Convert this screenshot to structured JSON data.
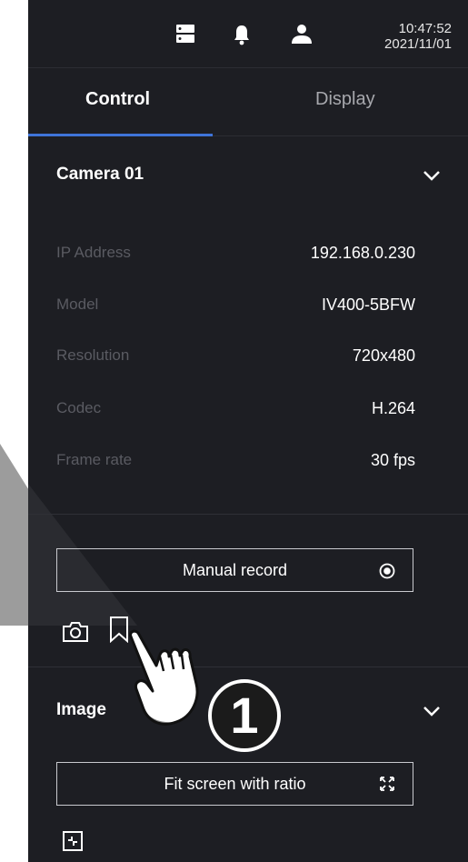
{
  "header": {
    "time": "10:47:52",
    "date": "2021/11/01",
    "icons": [
      "server-icon",
      "bell-icon",
      "user-icon"
    ]
  },
  "tabs": [
    {
      "label": "Control",
      "active": true
    },
    {
      "label": "Display",
      "active": false
    }
  ],
  "camera": {
    "title": "Camera 01",
    "rows": [
      {
        "label": "IP Address",
        "value": "192.168.0.230"
      },
      {
        "label": "Model",
        "value": "IV400-5BFW"
      },
      {
        "label": "Resolution",
        "value": "720x480"
      },
      {
        "label": "Codec",
        "value": "H.264"
      },
      {
        "label": "Frame rate",
        "value": "30 fps"
      }
    ],
    "record_button": "Manual record",
    "tools": [
      "camera-snapshot-icon",
      "bookmark-icon"
    ]
  },
  "image": {
    "title": "Image",
    "fit_button": "Fit screen with ratio",
    "tools": [
      "fit-original-icon"
    ]
  },
  "callout": {
    "step_number": "1"
  },
  "colors": {
    "panel_bg": "#1d1e23",
    "accent": "#3f74d9",
    "label_text": "#5a5b62"
  }
}
